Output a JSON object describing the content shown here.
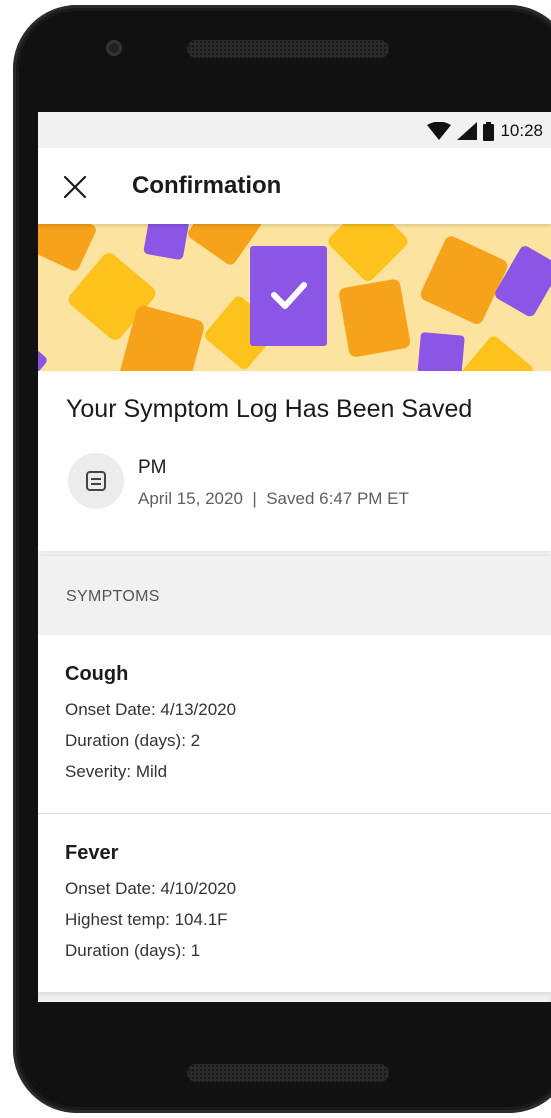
{
  "status_bar": {
    "time": "10:28"
  },
  "app_bar": {
    "title": "Confirmation"
  },
  "summary": {
    "title": "Your Symptom Log Has Been Saved",
    "log_name": "PM",
    "log_meta": "April 15, 2020  |  Saved 6:47 PM ET"
  },
  "symptoms_header": "SYMPTOMS",
  "symptoms": [
    {
      "name": "Cough",
      "lines": [
        "Onset Date: 4/13/2020",
        "Duration (days): 2",
        "Severity: Mild"
      ]
    },
    {
      "name": "Fever",
      "lines": [
        "Onset Date: 4/10/2020",
        "Highest temp: 104.1F",
        "Duration (days): 1"
      ]
    }
  ],
  "icons": {
    "close": "close-icon",
    "log": "log-icon",
    "check": "check-icon",
    "wifi": "wifi-icon",
    "signal": "signal-icon",
    "battery": "battery-icon"
  },
  "colors": {
    "banner_bg": "#fde3a0",
    "purple": "#8b55e6",
    "orange": "#f6a21a",
    "yellow": "#fdc21c"
  }
}
